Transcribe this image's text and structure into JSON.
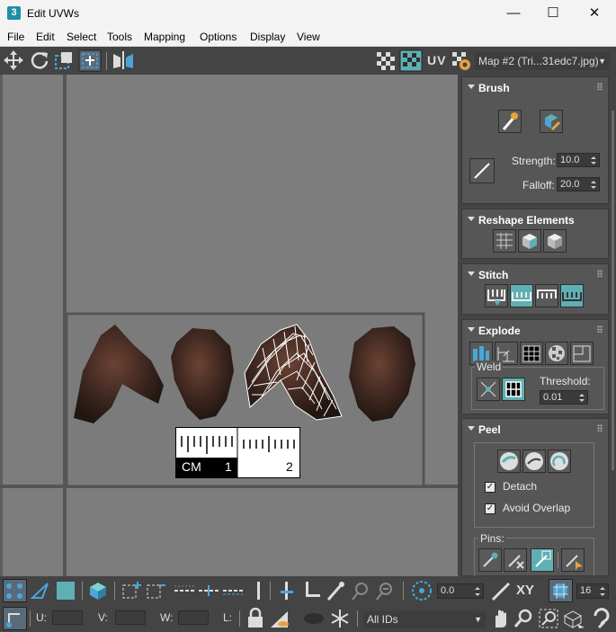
{
  "window": {
    "icon_text": "3",
    "title": "Edit UVWs",
    "minimize": "—",
    "maximize": "☐",
    "close": "✕"
  },
  "menu": [
    "File",
    "Edit",
    "Select",
    "Tools",
    "Mapping",
    "Options",
    "Display",
    "View"
  ],
  "toolbar": {
    "uv_label": "UV",
    "map_dropdown": "Map #2 (Tri...31edc7.jpg)"
  },
  "brush": {
    "title": "Brush",
    "strength_label": "Strength:",
    "strength_value": "10.0",
    "falloff_label": "Falloff:",
    "falloff_value": "20.0"
  },
  "reshape": {
    "title": "Reshape Elements"
  },
  "stitch": {
    "title": "Stitch"
  },
  "explode": {
    "title": "Explode",
    "weld_label": "Weld",
    "threshold_label": "Threshold:",
    "threshold_value": "0.01"
  },
  "peel": {
    "title": "Peel",
    "detach_label": "Detach",
    "detach_checked": true,
    "avoid_overlap_label": "Avoid Overlap",
    "avoid_overlap_checked": true,
    "pins_label": "Pins:"
  },
  "scale_bar": {
    "unit": "CM",
    "one": "1",
    "two": "2"
  },
  "bottom": {
    "rotate_value": "0.0",
    "xy_label": "XY",
    "grid_value": "16",
    "u_label": "U:",
    "v_label": "V:",
    "w_label": "W:",
    "l_label": "L:",
    "ids_dropdown": "All IDs"
  },
  "colors": {
    "accent_teal": "#5fb0b4",
    "icon_blue": "#4aa6d8",
    "background": "#444444",
    "viewport": "#7d7d7d"
  }
}
